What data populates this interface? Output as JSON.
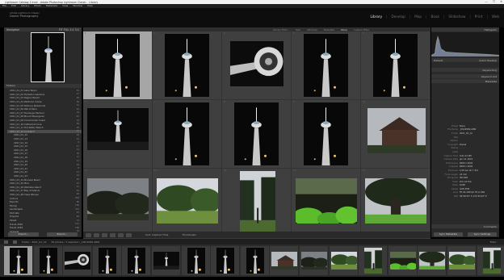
{
  "window": {
    "title": "Lightroom Catalog-2.lrcat - Adobe Photoshop Lightroom Classic - Library",
    "min": "—",
    "max": "☐",
    "close": "✕"
  },
  "menu": [
    "File",
    "Edit",
    "Library",
    "Photo",
    "Metadata",
    "View",
    "Window",
    "Help"
  ],
  "identity": {
    "subtitle": "Adobe Lightroom Classic",
    "catalog": "Daniel Photography"
  },
  "modules": [
    "Library",
    "Develop",
    "Map",
    "Book",
    "Slideshow",
    "Print",
    "Web"
  ],
  "active_module": "Library",
  "left": {
    "navigator": "Navigator",
    "fit": "FIT  FILL  1:1  3:1",
    "folders_header": "Folders",
    "folders": [
      {
        "name": "2021_01_01 Lake Taupo",
        "count": "54"
      },
      {
        "name": "2021_01_02 Hamilton Gardens",
        "count": "27"
      },
      {
        "name": "2021_01_03 Raglan Beach",
        "count": "48"
      },
      {
        "name": "2021_01_04 Waitomo Caves",
        "count": "36"
      },
      {
        "name": "2021_01_05 Rotorua Redwoods",
        "count": "31"
      },
      {
        "name": "2021_01_06 Wai-O-Tapu",
        "count": "22"
      },
      {
        "name": "2021_01_07 Tauranga Harbour",
        "count": "19"
      },
      {
        "name": "2021_01_08 Mount Maunganui",
        "count": "41"
      },
      {
        "name": "2021_01_09 Coromandel Coast",
        "count": "33"
      },
      {
        "name": "2021_01_10 Cathedral Cove",
        "count": "58"
      },
      {
        "name": "2021_01_11 Hot Water Beach",
        "count": "25"
      },
      {
        "name": "2021_01_12 Auckland",
        "count": "45"
      },
      {
        "name": "2021_01_12",
        "count": "18"
      },
      {
        "name": "2021_01_13",
        "count": "12"
      },
      {
        "name": "2021_01_14",
        "count": "9"
      },
      {
        "name": "2021_01_15",
        "count": "21"
      },
      {
        "name": "2021_01_16",
        "count": "14"
      },
      {
        "name": "2021_01_17",
        "count": "30"
      },
      {
        "name": "2021_01_18",
        "count": "17"
      },
      {
        "name": "2021_01_19",
        "count": "11"
      },
      {
        "name": "2021_01_20",
        "count": "26"
      },
      {
        "name": "2021_01_21",
        "count": "8"
      },
      {
        "name": "2021_01_22",
        "count": "13"
      },
      {
        "name": "2021_01_23",
        "count": "19"
      },
      {
        "name": "2021_01_24 Muriwai Beach",
        "count": "40"
      },
      {
        "name": "2021_01_25 Piha",
        "count": "23"
      },
      {
        "name": "2021_01_26 Waiheke Island",
        "count": "37"
      },
      {
        "name": "2021_01_27 Bay of Islands",
        "count": "52"
      },
      {
        "name": "2021_01_28 Cape Reinga",
        "count": "28"
      },
      {
        "name": "Archive",
        "count": "204"
      },
      {
        "name": "Exports",
        "count": "88"
      },
      {
        "name": "Family",
        "count": "156"
      },
      {
        "name": "Landscapes",
        "count": "312"
      },
      {
        "name": "Portraits",
        "count": "97"
      },
      {
        "name": "Projects",
        "count": "64"
      },
      {
        "name": "Street",
        "count": "73"
      },
      {
        "name": "Travel 2020",
        "count": "141"
      },
      {
        "name": "Travel 2019",
        "count": "188"
      },
      {
        "name": "Uploads",
        "count": "33"
      }
    ],
    "import_btn": "Import...",
    "export_btn": "Export..."
  },
  "center": {
    "filter": [
      "Library Filter :",
      "Text",
      "Attribute",
      "Metadata",
      "None",
      "Custom Filter"
    ],
    "filter_active": "None",
    "toolbar": {
      "sort_label": "Sort: Capture Time",
      "thumb_label": "Thumbnails"
    },
    "cells": [
      {
        "num": "1",
        "type": "tower",
        "sel": true
      },
      {
        "num": "2",
        "type": "tower"
      },
      {
        "num": "3",
        "type": "tower-up"
      },
      {
        "num": "4",
        "type": "tower"
      },
      {
        "num": "5",
        "type": "tower"
      },
      {
        "num": "6",
        "type": "tower-wide"
      },
      {
        "num": "7",
        "type": "tower"
      },
      {
        "num": "8",
        "type": "tower"
      },
      {
        "num": "9",
        "type": "tower"
      },
      {
        "num": "10",
        "type": "house"
      },
      {
        "num": "11",
        "type": "trees-night"
      },
      {
        "num": "12",
        "type": "park"
      },
      {
        "num": "13",
        "type": "forest"
      },
      {
        "num": "14",
        "type": "plants"
      },
      {
        "num": "15",
        "type": "bigtree"
      }
    ]
  },
  "right": {
    "histogram": "Histogram",
    "quick": "Quick Develop",
    "keywording": "Keywording",
    "keyword_list": "Keyword List",
    "metadata": "Metadata",
    "preset": "Default",
    "meta_rows": [
      {
        "label": "Preset",
        "value": "None"
      },
      {
        "label": "File Name",
        "value": "_DSC4582.ARW"
      },
      {
        "label": "Folder",
        "value": "2021_01_12"
      },
      {
        "label": "Title",
        "value": ""
      },
      {
        "label": "Caption",
        "value": ""
      },
      {
        "label": "Copyright",
        "value": "Daniel"
      },
      {
        "label": "Rating",
        "value": "· · · · ·"
      },
      {
        "label": "Label",
        "value": ""
      },
      {
        "label": "Capture Time",
        "value": "9:41:12 PM"
      },
      {
        "label": "Capture Date",
        "value": "Jan 12, 2021"
      },
      {
        "label": "Dimensions",
        "value": "6000 x 4000"
      },
      {
        "label": "Cropped",
        "value": "6000 x 4000"
      },
      {
        "label": "Exposure",
        "value": "1/10 sec at f / 8.0"
      },
      {
        "label": "Focal Length",
        "value": "24 mm"
      },
      {
        "label": "ISO Speed",
        "value": "ISO 800"
      },
      {
        "label": "Flash",
        "value": "Did not fire"
      },
      {
        "label": "Make",
        "value": "SONY"
      },
      {
        "label": "Model",
        "value": "ILCE-7M3"
      },
      {
        "label": "Lens",
        "value": "FE 24-105mm F4 G OSS"
      },
      {
        "label": "GPS",
        "value": "36°50'54\" S 174°45'43\" E"
      }
    ],
    "sync_meta": "Sync Metadata",
    "sync_settings": "Sync Settings",
    "comments": "Comments"
  },
  "filmstrip_bar": {
    "path": "Folder : 2021_01_12",
    "count": "45 photos / 1 selected / _DSC4582.ARW",
    "filter": "Filter :"
  },
  "filmstrip": [
    {
      "type": "tower",
      "sel": true
    },
    {
      "type": "tower"
    },
    {
      "type": "tower-up"
    },
    {
      "type": "tower"
    },
    {
      "type": "tower"
    },
    {
      "type": "tower-wide"
    },
    {
      "type": "tower"
    },
    {
      "type": "tower"
    },
    {
      "type": "tower"
    },
    {
      "type": "house"
    },
    {
      "type": "trees-night"
    },
    {
      "type": "park"
    },
    {
      "type": "forest"
    },
    {
      "type": "plants"
    },
    {
      "type": "bigtree"
    },
    {
      "type": "park"
    },
    {
      "type": "forest"
    }
  ],
  "colors": {
    "selected": "#a6a6a6",
    "cell": "#3f3f3f",
    "panel": "#2a2a2a"
  }
}
